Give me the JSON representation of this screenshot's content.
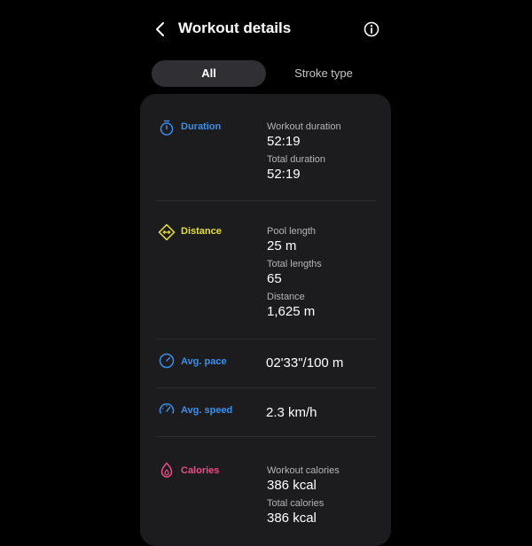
{
  "header": {
    "title": "Workout details"
  },
  "tabs": [
    {
      "label": "All"
    },
    {
      "label": "Stroke type"
    }
  ],
  "sections": {
    "duration": {
      "label": "Duration",
      "color": "#3b8fea",
      "rows": [
        {
          "k": "Workout duration",
          "v": "52:19"
        },
        {
          "k": "Total duration",
          "v": "52:19"
        }
      ]
    },
    "distance": {
      "label": "Distance",
      "color": "#e4dd3a",
      "rows": [
        {
          "k": "Pool length",
          "v": "25 m"
        },
        {
          "k": "Total lengths",
          "v": "65"
        },
        {
          "k": "Distance",
          "v": "1,625 m"
        }
      ]
    },
    "pace": {
      "label": "Avg. pace",
      "color": "#3b8fea",
      "value": "02'33\"/100 m"
    },
    "speed": {
      "label": "Avg. speed",
      "color": "#3b8fea",
      "value": "2.3 km/h"
    },
    "calories": {
      "label": "Calories",
      "color": "#ef4a8a",
      "rows": [
        {
          "k": "Workout calories",
          "v": "386 kcal"
        },
        {
          "k": "Total calories",
          "v": "386 kcal"
        }
      ]
    }
  },
  "icons": [
    "back-icon",
    "info-icon",
    "stopwatch-icon",
    "distance-icon",
    "pace-icon",
    "speedometer-icon",
    "flame-icon"
  ]
}
